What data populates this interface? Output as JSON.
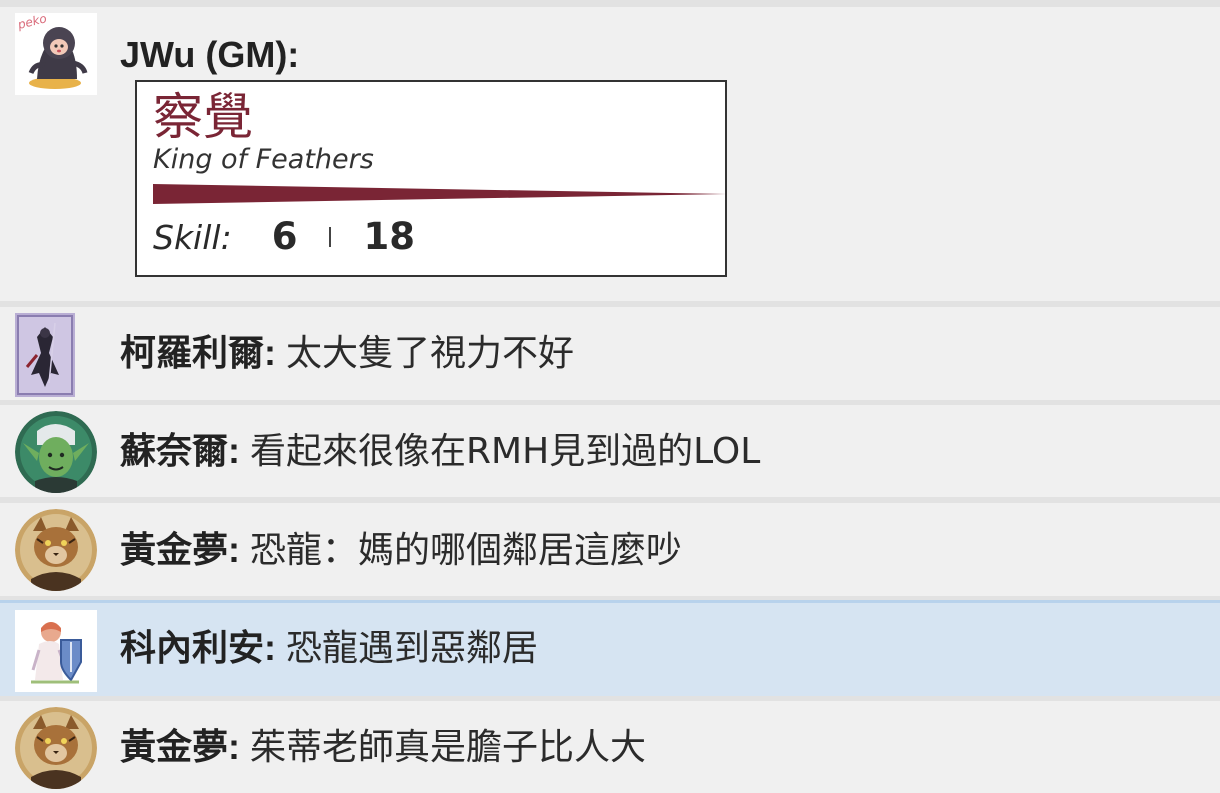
{
  "messages": [
    {
      "sender": "JWu (GM):",
      "avatar_icon": "hooded-chibi-avatar-icon",
      "avatar_label": "peko",
      "card": {
        "title": "察覺",
        "subtitle": "King of Feathers",
        "stat_label": "Skill:",
        "value_a": "6",
        "value_b": "18",
        "accent_color": "#7a2535"
      }
    },
    {
      "sender": "柯羅利爾:",
      "text": "太大隻了視力不好",
      "avatar_icon": "dark-knight-avatar-icon"
    },
    {
      "sender": "蘇奈爾:",
      "text": "看起來很像在RMH見到過的LOL",
      "avatar_icon": "green-elf-avatar-icon"
    },
    {
      "sender": "黃金夢:",
      "text": "恐龍：媽的哪個鄰居這麼吵",
      "avatar_icon": "tabaxi-cat-avatar-icon"
    },
    {
      "sender": "科內利安:",
      "text": "恐龍遇到惡鄰居",
      "avatar_icon": "paladin-shield-avatar-icon",
      "highlighted": true
    },
    {
      "sender": "黃金夢:",
      "text": "茱蒂老師真是膽子比人大",
      "avatar_icon": "tabaxi-cat-avatar-icon"
    }
  ],
  "colors": {
    "row_bg": "#f0f0f0",
    "row_highlight": "#d6e4f2",
    "divider": "#e2e2e2"
  }
}
